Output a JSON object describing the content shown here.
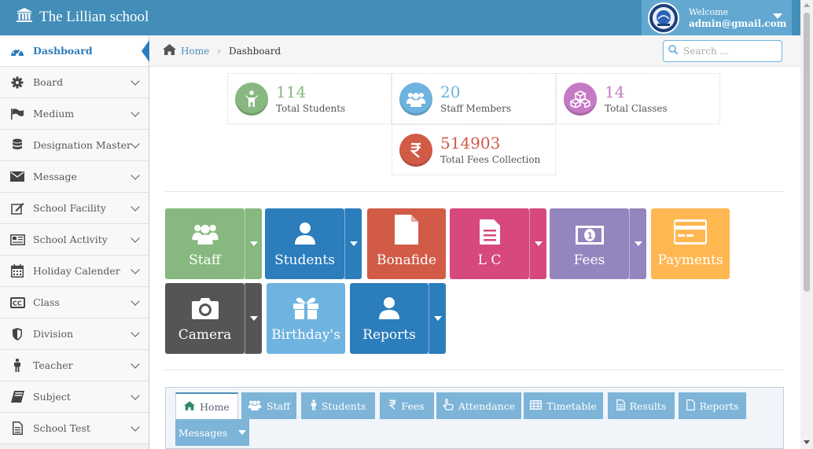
{
  "app": {
    "title": "The Lillian school"
  },
  "user": {
    "welcome": "Welcome",
    "email": "admin@gmail.com"
  },
  "sidebar": {
    "items": [
      {
        "label": "Dashboard"
      },
      {
        "label": "Board"
      },
      {
        "label": "Medium"
      },
      {
        "label": "Designation Master"
      },
      {
        "label": "Message"
      },
      {
        "label": "School Facility"
      },
      {
        "label": "School Activity"
      },
      {
        "label": "Holiday Calender"
      },
      {
        "label": "Class"
      },
      {
        "label": "Division"
      },
      {
        "label": "Teacher"
      },
      {
        "label": "Subject"
      },
      {
        "label": "School Test"
      }
    ]
  },
  "breadcrumb": {
    "home": "Home",
    "current": "Dashboard"
  },
  "search": {
    "placeholder": "Search ..."
  },
  "stats": {
    "students": {
      "value": "114",
      "label": "Total Students",
      "color": "#87b87f"
    },
    "staff": {
      "value": "20",
      "label": "Staff Members",
      "color": "#6fb3e0"
    },
    "classes": {
      "value": "14",
      "label": "Total Classes",
      "color": "#c679c4"
    },
    "fees": {
      "value": "514903",
      "label": "Total Fees Collection",
      "color": "#d15b47"
    }
  },
  "shortcuts": {
    "staff": "Staff",
    "students": "Students",
    "bonafide": "Bonafide",
    "lc": "L C",
    "fees": "Fees",
    "payments": "Payments",
    "camera": "Camera",
    "birthdays": "Birthday's",
    "reports": "Reports"
  },
  "tabs": {
    "home": "Home",
    "staff": "Staff",
    "students": "Students",
    "fees": "Fees",
    "attendance": "Attendance",
    "timetable": "Timetable",
    "results": "Results",
    "reports": "Reports",
    "messages": "Messages"
  }
}
